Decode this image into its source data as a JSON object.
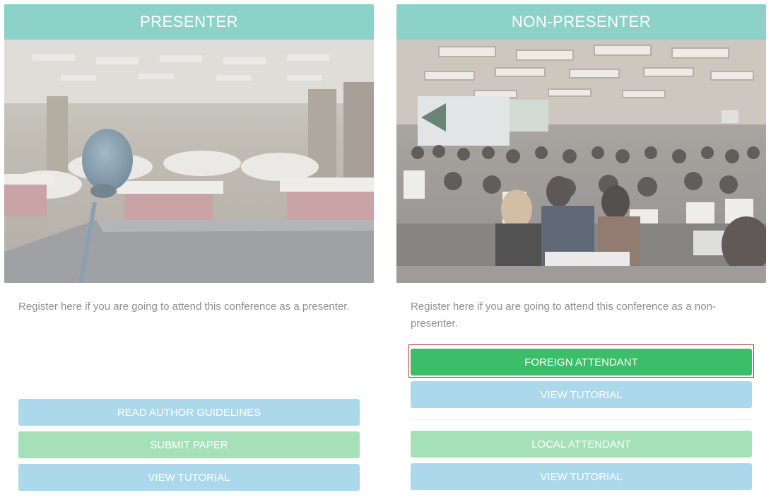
{
  "presenter": {
    "title": "PRESENTER",
    "description": "Register here if you are going to attend this conference as a presenter.",
    "buttons": {
      "guidelines": "READ AUTHOR GUIDELINES",
      "submit": "SUBMIT PAPER",
      "tutorial": "VIEW TUTORIAL"
    }
  },
  "nonpresenter": {
    "title": "NON-PRESENTER",
    "description": "Register here if you are going to attend this conference as a non-presenter.",
    "buttons": {
      "foreign": "FOREIGN ATTENDANT",
      "foreign_tutorial": "VIEW TUTORIAL",
      "local": "LOCAL ATTENDANT",
      "local_tutorial": "VIEW TUTORIAL"
    }
  },
  "colors": {
    "header": "#8dd2c9",
    "button_blue": "#acd8ec",
    "button_green_light": "#a6e0b8",
    "button_green": "#3cbd6a",
    "focus_outline": "#b33b3b"
  }
}
